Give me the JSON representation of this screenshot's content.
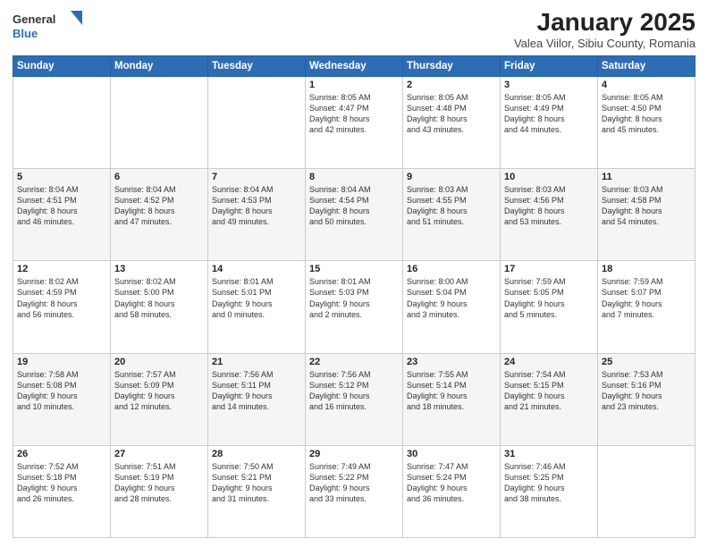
{
  "header": {
    "logo_general": "General",
    "logo_blue": "Blue",
    "title": "January 2025",
    "subtitle": "Valea Viilor, Sibiu County, Romania"
  },
  "weekdays": [
    "Sunday",
    "Monday",
    "Tuesday",
    "Wednesday",
    "Thursday",
    "Friday",
    "Saturday"
  ],
  "weeks": [
    [
      {
        "day": "",
        "info": ""
      },
      {
        "day": "",
        "info": ""
      },
      {
        "day": "",
        "info": ""
      },
      {
        "day": "1",
        "info": "Sunrise: 8:05 AM\nSunset: 4:47 PM\nDaylight: 8 hours\nand 42 minutes."
      },
      {
        "day": "2",
        "info": "Sunrise: 8:05 AM\nSunset: 4:48 PM\nDaylight: 8 hours\nand 43 minutes."
      },
      {
        "day": "3",
        "info": "Sunrise: 8:05 AM\nSunset: 4:49 PM\nDaylight: 8 hours\nand 44 minutes."
      },
      {
        "day": "4",
        "info": "Sunrise: 8:05 AM\nSunset: 4:50 PM\nDaylight: 8 hours\nand 45 minutes."
      }
    ],
    [
      {
        "day": "5",
        "info": "Sunrise: 8:04 AM\nSunset: 4:51 PM\nDaylight: 8 hours\nand 46 minutes."
      },
      {
        "day": "6",
        "info": "Sunrise: 8:04 AM\nSunset: 4:52 PM\nDaylight: 8 hours\nand 47 minutes."
      },
      {
        "day": "7",
        "info": "Sunrise: 8:04 AM\nSunset: 4:53 PM\nDaylight: 8 hours\nand 49 minutes."
      },
      {
        "day": "8",
        "info": "Sunrise: 8:04 AM\nSunset: 4:54 PM\nDaylight: 8 hours\nand 50 minutes."
      },
      {
        "day": "9",
        "info": "Sunrise: 8:03 AM\nSunset: 4:55 PM\nDaylight: 8 hours\nand 51 minutes."
      },
      {
        "day": "10",
        "info": "Sunrise: 8:03 AM\nSunset: 4:56 PM\nDaylight: 8 hours\nand 53 minutes."
      },
      {
        "day": "11",
        "info": "Sunrise: 8:03 AM\nSunset: 4:58 PM\nDaylight: 8 hours\nand 54 minutes."
      }
    ],
    [
      {
        "day": "12",
        "info": "Sunrise: 8:02 AM\nSunset: 4:59 PM\nDaylight: 8 hours\nand 56 minutes."
      },
      {
        "day": "13",
        "info": "Sunrise: 8:02 AM\nSunset: 5:00 PM\nDaylight: 8 hours\nand 58 minutes."
      },
      {
        "day": "14",
        "info": "Sunrise: 8:01 AM\nSunset: 5:01 PM\nDaylight: 9 hours\nand 0 minutes."
      },
      {
        "day": "15",
        "info": "Sunrise: 8:01 AM\nSunset: 5:03 PM\nDaylight: 9 hours\nand 2 minutes."
      },
      {
        "day": "16",
        "info": "Sunrise: 8:00 AM\nSunset: 5:04 PM\nDaylight: 9 hours\nand 3 minutes."
      },
      {
        "day": "17",
        "info": "Sunrise: 7:59 AM\nSunset: 5:05 PM\nDaylight: 9 hours\nand 5 minutes."
      },
      {
        "day": "18",
        "info": "Sunrise: 7:59 AM\nSunset: 5:07 PM\nDaylight: 9 hours\nand 7 minutes."
      }
    ],
    [
      {
        "day": "19",
        "info": "Sunrise: 7:58 AM\nSunset: 5:08 PM\nDaylight: 9 hours\nand 10 minutes."
      },
      {
        "day": "20",
        "info": "Sunrise: 7:57 AM\nSunset: 5:09 PM\nDaylight: 9 hours\nand 12 minutes."
      },
      {
        "day": "21",
        "info": "Sunrise: 7:56 AM\nSunset: 5:11 PM\nDaylight: 9 hours\nand 14 minutes."
      },
      {
        "day": "22",
        "info": "Sunrise: 7:56 AM\nSunset: 5:12 PM\nDaylight: 9 hours\nand 16 minutes."
      },
      {
        "day": "23",
        "info": "Sunrise: 7:55 AM\nSunset: 5:14 PM\nDaylight: 9 hours\nand 18 minutes."
      },
      {
        "day": "24",
        "info": "Sunrise: 7:54 AM\nSunset: 5:15 PM\nDaylight: 9 hours\nand 21 minutes."
      },
      {
        "day": "25",
        "info": "Sunrise: 7:53 AM\nSunset: 5:16 PM\nDaylight: 9 hours\nand 23 minutes."
      }
    ],
    [
      {
        "day": "26",
        "info": "Sunrise: 7:52 AM\nSunset: 5:18 PM\nDaylight: 9 hours\nand 26 minutes."
      },
      {
        "day": "27",
        "info": "Sunrise: 7:51 AM\nSunset: 5:19 PM\nDaylight: 9 hours\nand 28 minutes."
      },
      {
        "day": "28",
        "info": "Sunrise: 7:50 AM\nSunset: 5:21 PM\nDaylight: 9 hours\nand 31 minutes."
      },
      {
        "day": "29",
        "info": "Sunrise: 7:49 AM\nSunset: 5:22 PM\nDaylight: 9 hours\nand 33 minutes."
      },
      {
        "day": "30",
        "info": "Sunrise: 7:47 AM\nSunset: 5:24 PM\nDaylight: 9 hours\nand 36 minutes."
      },
      {
        "day": "31",
        "info": "Sunrise: 7:46 AM\nSunset: 5:25 PM\nDaylight: 9 hours\nand 38 minutes."
      },
      {
        "day": "",
        "info": ""
      }
    ]
  ]
}
